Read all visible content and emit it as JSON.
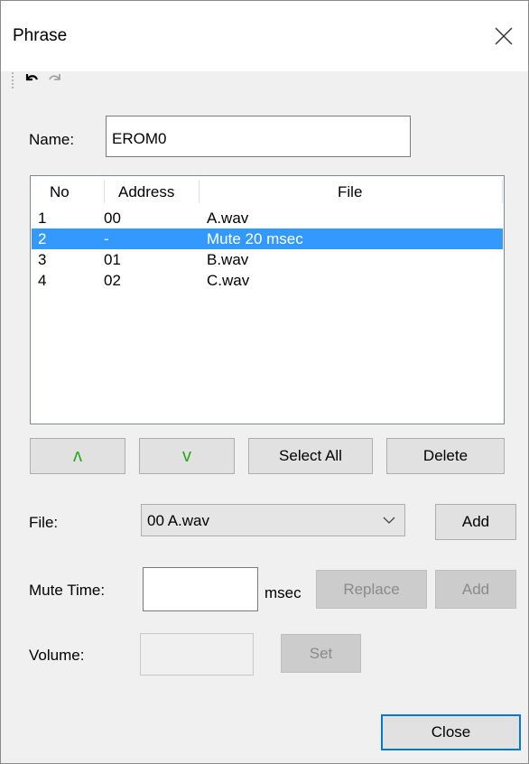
{
  "window": {
    "title": "Phrase"
  },
  "name": {
    "label": "Name:",
    "value": "EROM0"
  },
  "list": {
    "columns": [
      "No",
      "Address",
      "File"
    ],
    "rows": [
      {
        "no": "1",
        "address": "00",
        "file": "A.wav",
        "selected": false
      },
      {
        "no": "2",
        "address": "-",
        "file": "Mute 20 msec",
        "selected": true
      },
      {
        "no": "3",
        "address": "01",
        "file": "B.wav",
        "selected": false
      },
      {
        "no": "4",
        "address": "02",
        "file": "C.wav",
        "selected": false
      }
    ]
  },
  "list_buttons": {
    "up": "ʌ",
    "down": "v",
    "select_all": "Select All",
    "delete": "Delete"
  },
  "file": {
    "label": "File:",
    "selected": "00 A.wav",
    "add": "Add"
  },
  "mute": {
    "label": "Mute Time:",
    "value": "",
    "unit": "msec",
    "replace": "Replace",
    "add": "Add"
  },
  "volume": {
    "label": "Volume:",
    "value": "",
    "set": "Set"
  },
  "footer": {
    "close": "Close"
  },
  "colors": {
    "selection": "#3399ff",
    "accent": "#0078d7",
    "arrow": "#2aa61f"
  }
}
